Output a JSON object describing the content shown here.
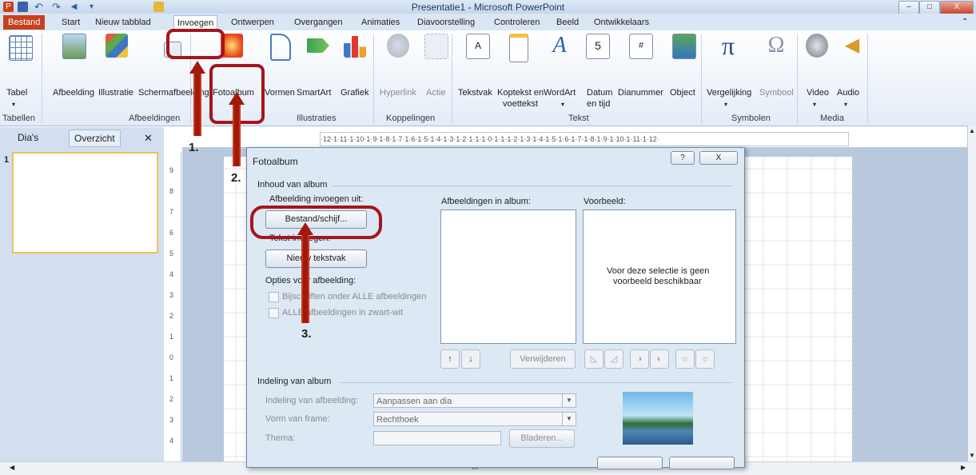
{
  "window": {
    "title": "Presentatie1 - Microsoft PowerPoint",
    "controls": {
      "minimize": "–",
      "maximize": "□",
      "close": "X"
    }
  },
  "ribbon_tabs": [
    {
      "label": "Bestand"
    },
    {
      "label": "Start"
    },
    {
      "label": "Nieuw tabblad"
    },
    {
      "label": "Invoegen"
    },
    {
      "label": "Ontwerpen"
    },
    {
      "label": "Overgangen"
    },
    {
      "label": "Animaties"
    },
    {
      "label": "Diavoorstelling"
    },
    {
      "label": "Controleren"
    },
    {
      "label": "Beeld"
    },
    {
      "label": "Ontwikkelaars"
    }
  ],
  "ribbon": {
    "buttons": {
      "tabel": "Tabel",
      "afbeelding": "Afbeelding",
      "illustratie": "Illustratie",
      "schermafbeelding": "Schermafbeelding",
      "fotoalbum": "Fotoalbum",
      "vormen": "Vormen",
      "smartart": "SmartArt",
      "grafiek": "Grafiek",
      "hyperlink": "Hyperlink",
      "actie": "Actie",
      "tekstvak": "Tekstvak",
      "koptekst_line1": "Koptekst en",
      "koptekst_line2": "voettekst",
      "wordart": "WordArt",
      "datum_line1": "Datum",
      "datum_line2": "en tijd",
      "dianummer": "Dianummer",
      "object": "Object",
      "vergelijking": "Vergelijking",
      "symbool": "Symbool",
      "video": "Video",
      "audio": "Audio"
    },
    "groups": {
      "tabellen": "Tabellen",
      "afbeeldingen": "Afbeeldingen",
      "illustraties": "Illustraties",
      "koppelingen": "Koppelingen",
      "tekst": "Tekst",
      "symbolen": "Symbolen",
      "media": "Media"
    }
  },
  "slides_pane": {
    "tab_dias": "Dia's",
    "tab_overzicht": "Overzicht",
    "close": "✕",
    "slide_number": "1"
  },
  "ruler": {
    "horizontal": "·12·1·11·1·10·1·9·1·8·1·7·1·6·1·5·1·4·1·3·1·2·1·1·1·0·1·1·1·2·1·3·1·4·1·5·1·6·1·7·1·8·1·9·1·10·1·11·1·12·",
    "vertical": [
      "9",
      "8",
      "7",
      "6",
      "5",
      "4",
      "3",
      "2",
      "1",
      "0",
      "1",
      "2",
      "3",
      "4"
    ]
  },
  "dialog": {
    "title": "Fotoalbum",
    "help": "?",
    "close": "X",
    "section_inhoud": "Inhoud van album",
    "insert_from_label": "Afbeelding invoegen uit:",
    "bestand_button": "Bestand/schijf...",
    "tekst_invoegen_label": "Tekst invoegen:",
    "nieuw_tekstvak_button": "Nieuw tekstvak",
    "opties_label": "Opties voor afbeelding:",
    "bijschriften": "Bijschriften onder ALLE afbeeldingen",
    "zwartwit": "ALLE afbeeldingen in zwart-wit",
    "afbeeldingen_in_album": "Afbeeldingen in album:",
    "voorbeeld_label": "Voorbeeld:",
    "preview_text_line1": "Voor deze selectie is geen",
    "preview_text_line2": "voorbeeld beschikbaar",
    "move_up": "↑",
    "move_down": "↓",
    "verwijderen": "Verwijderen",
    "section_indeling": "Indeling van album",
    "indeling_afbeelding_label": "Indeling van afbeelding:",
    "indeling_afbeelding_value": "Aanpassen aan dia",
    "vorm_frame_label": "Vorm van frame:",
    "vorm_frame_value": "Rechthoek",
    "thema_label": "Thema:",
    "bladeren_button": "Bladeren..."
  },
  "annotations": {
    "step1": "1.",
    "step2": "2.",
    "step3": "3.",
    "color": "#a3161c"
  },
  "scrollbar": {
    "mid": "III"
  }
}
